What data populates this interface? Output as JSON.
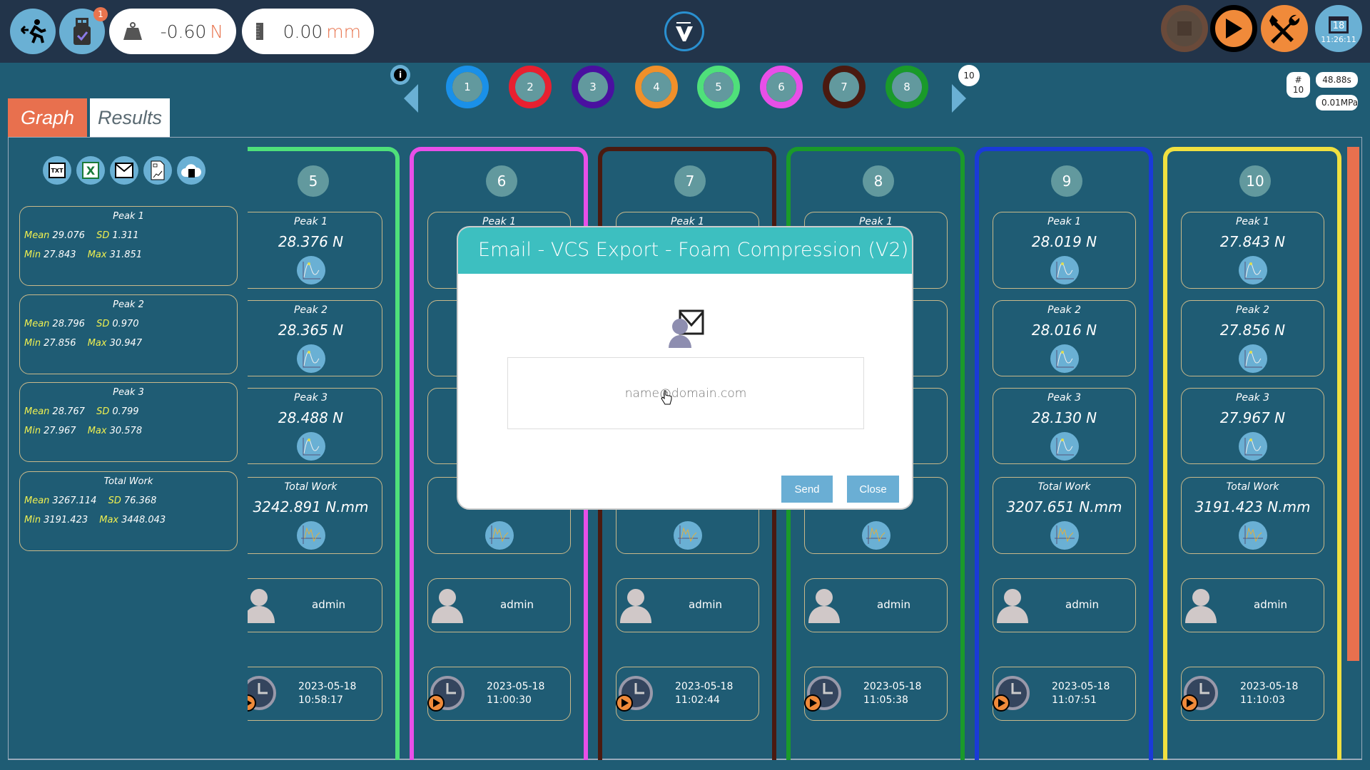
{
  "topbar": {
    "usb_badge": "1",
    "force": {
      "value": "-0.60",
      "unit": "N"
    },
    "displacement": {
      "value": "0.00",
      "unit": "mm"
    },
    "clock": {
      "day": "18",
      "time": "11:26:11"
    }
  },
  "nav": {
    "circles": [
      {
        "label": "1",
        "color": "#1a90e8"
      },
      {
        "label": "2",
        "color": "#e82030"
      },
      {
        "label": "3",
        "color": "#4a10a0"
      },
      {
        "label": "4",
        "color": "#f0902a"
      },
      {
        "label": "5",
        "color": "#4fe07a"
      },
      {
        "label": "6",
        "color": "#e84fe8"
      },
      {
        "label": "7",
        "color": "#4a1a10"
      },
      {
        "label": "8",
        "color": "#1a9a2a"
      }
    ],
    "count_badge": "10"
  },
  "status": {
    "test_no": "# 10",
    "duration": "48.88s",
    "pressure": "0.01MPa"
  },
  "tabs": {
    "graph": "Graph",
    "results": "Results"
  },
  "labels": {
    "mean": "Mean",
    "sd": "SD",
    "min": "Min",
    "max": "Max"
  },
  "summary": [
    {
      "title": "Peak 1",
      "mean": "29.076",
      "sd": "1.311",
      "min": "27.843",
      "max": "31.851"
    },
    {
      "title": "Peak 2",
      "mean": "28.796",
      "sd": "0.970",
      "min": "27.856",
      "max": "30.947"
    },
    {
      "title": "Peak 3",
      "mean": "28.767",
      "sd": "0.799",
      "min": "27.967",
      "max": "30.578"
    },
    {
      "title": "Total Work",
      "mean": "3267.114",
      "sd": "76.368",
      "min": "3191.423",
      "max": "3448.043"
    }
  ],
  "card_titles": [
    "Peak 1",
    "Peak 2",
    "Peak 3",
    "Total Work"
  ],
  "columns": [
    {
      "num": "5",
      "color": "#4fe07a",
      "values": [
        "28.376 N",
        "28.365 N",
        "28.488 N",
        "3242.891 N.mm"
      ],
      "user": "admin",
      "date": "2023-05-18",
      "time": "10:58:17"
    },
    {
      "num": "6",
      "color": "#e84fe8",
      "values": [
        "",
        "",
        "",
        ""
      ],
      "user": "admin",
      "date": "2023-05-18",
      "time": "11:00:30"
    },
    {
      "num": "7",
      "color": "#4a1a10",
      "values": [
        "",
        "",
        "",
        ""
      ],
      "user": "admin",
      "date": "2023-05-18",
      "time": "11:02:44"
    },
    {
      "num": "8",
      "color": "#1a9a2a",
      "values": [
        "",
        "",
        "",
        ""
      ],
      "user": "admin",
      "date": "2023-05-18",
      "time": "11:05:38"
    },
    {
      "num": "9",
      "color": "#1a3ad8",
      "values": [
        "28.019 N",
        "28.016 N",
        "28.130 N",
        "3207.651 N.mm"
      ],
      "user": "admin",
      "date": "2023-05-18",
      "time": "11:07:51"
    },
    {
      "num": "10",
      "color": "#f0e040",
      "values": [
        "27.843 N",
        "27.856 N",
        "27.967 N",
        "3191.423 N.mm"
      ],
      "user": "admin",
      "date": "2023-05-18",
      "time": "11:10:03"
    }
  ],
  "modal": {
    "title": "Email - VCS Export - Foam Compression (V2) |...",
    "placeholder": "name@domain.com",
    "send": "Send",
    "close": "Close"
  }
}
